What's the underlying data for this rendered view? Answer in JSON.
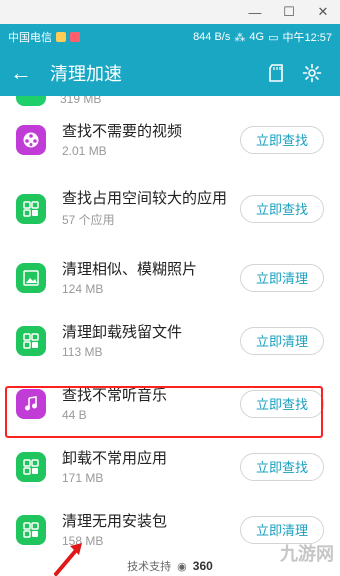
{
  "statusbar": {
    "carrier": "中国电信",
    "speed": "844 B/s",
    "network": "4G",
    "time": "中午12:57"
  },
  "appbar": {
    "title": "清理加速"
  },
  "partial_row": {
    "size": "319 MB"
  },
  "items": [
    {
      "name": "查找不需要的视频",
      "sub": "2.01 MB",
      "button": "立即查找",
      "icon": "video-icon",
      "color": "purple"
    },
    {
      "name": "查找占用空间较大的应用",
      "sub": "57 个应用",
      "button": "立即查找",
      "icon": "apps-grid-icon",
      "color": "green"
    },
    {
      "name": "清理相似、模糊照片",
      "sub": "124 MB",
      "button": "立即清理",
      "icon": "photo-icon",
      "color": "green"
    },
    {
      "name": "清理卸载残留文件",
      "sub": "113 MB",
      "button": "立即清理",
      "icon": "apps-grid-icon",
      "color": "green"
    },
    {
      "name": "查找不常听音乐",
      "sub": "44 B",
      "button": "立即查找",
      "icon": "music-icon",
      "color": "purple"
    },
    {
      "name": "卸载不常用应用",
      "sub": "171 MB",
      "button": "立即查找",
      "icon": "apps-grid-icon",
      "color": "green"
    },
    {
      "name": "清理无用安装包",
      "sub": "158 MB",
      "button": "立即清理",
      "icon": "apps-grid-icon",
      "color": "green"
    }
  ],
  "footer": {
    "label": "技术支持",
    "brand": "360"
  },
  "watermark": "九游网"
}
